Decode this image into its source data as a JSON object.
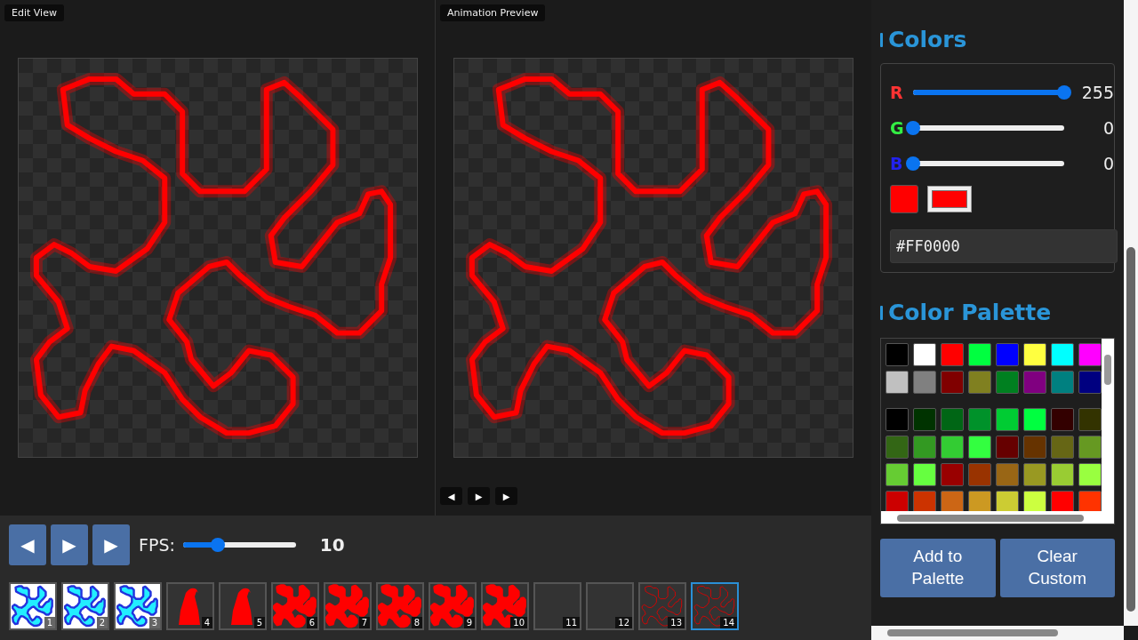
{
  "edit_view": {
    "title": "Edit View"
  },
  "preview": {
    "title": "Animation Preview",
    "controls": [
      "◀",
      "▶",
      "▶"
    ]
  },
  "playback": {
    "buttons": [
      "◀",
      "▶",
      "▶"
    ],
    "fps": {
      "label": "FPS:",
      "level": 0.31,
      "value": "10"
    }
  },
  "frames": [
    {
      "number": "1",
      "kind": "blue-blob",
      "selected": false
    },
    {
      "number": "2",
      "kind": "blue-blob",
      "selected": false
    },
    {
      "number": "3",
      "kind": "blue-blob",
      "selected": false
    },
    {
      "number": "4",
      "kind": "red-ghost",
      "selected": false
    },
    {
      "number": "5",
      "kind": "red-ghost",
      "selected": false
    },
    {
      "number": "6",
      "kind": "red-blob",
      "selected": false
    },
    {
      "number": "7",
      "kind": "red-blob",
      "selected": false
    },
    {
      "number": "8",
      "kind": "red-blob",
      "selected": false
    },
    {
      "number": "9",
      "kind": "red-blob",
      "selected": false
    },
    {
      "number": "10",
      "kind": "red-blob",
      "selected": false
    },
    {
      "number": "11",
      "kind": "empty",
      "selected": false
    },
    {
      "number": "12",
      "kind": "empty",
      "selected": false
    },
    {
      "number": "13",
      "kind": "red-outline",
      "selected": false
    },
    {
      "number": "14",
      "kind": "red-outline",
      "selected": true
    }
  ],
  "colors": {
    "title": "Colors",
    "channels": [
      {
        "label": "R",
        "color": "#ff3333",
        "level": 1,
        "value": "255"
      },
      {
        "label": "G",
        "color": "#33ee44",
        "level": 0,
        "value": "0"
      },
      {
        "label": "B",
        "color": "#2222ee",
        "level": 0,
        "value": "0"
      }
    ],
    "hex": "#FF0000"
  },
  "palette": {
    "title": "Color Palette",
    "base": [
      {
        "color": "#000000"
      },
      {
        "color": "#ffffff"
      },
      {
        "color": "#ff0000"
      },
      {
        "color": "#00ff40"
      },
      {
        "color": "#0000ff"
      },
      {
        "color": "#ffff40"
      },
      {
        "color": "#00ffff"
      },
      {
        "color": "#ff00ff"
      },
      {
        "color": "#c0c0c0"
      },
      {
        "color": "#808080"
      },
      {
        "color": "#800000"
      },
      {
        "color": "#808020"
      },
      {
        "color": "#008020"
      },
      {
        "color": "#800080"
      },
      {
        "color": "#008080"
      },
      {
        "color": "#000080"
      }
    ],
    "custom": [
      {
        "color": "#000000"
      },
      {
        "color": "#003300"
      },
      {
        "color": "#006615"
      },
      {
        "color": "#00922a"
      },
      {
        "color": "#00cc33"
      },
      {
        "color": "#00ff40"
      },
      {
        "color": "#330000"
      },
      {
        "color": "#333300"
      },
      {
        "color": "#336615"
      },
      {
        "color": "#339922"
      },
      {
        "color": "#33cc33"
      },
      {
        "color": "#33ff40"
      },
      {
        "color": "#660000"
      },
      {
        "color": "#663300"
      },
      {
        "color": "#666615"
      },
      {
        "color": "#669922"
      },
      {
        "color": "#66cc33"
      },
      {
        "color": "#66ff40"
      },
      {
        "color": "#990000"
      },
      {
        "color": "#993300"
      },
      {
        "color": "#996615"
      },
      {
        "color": "#999922"
      },
      {
        "color": "#99cc33"
      },
      {
        "color": "#99ff40"
      },
      {
        "color": "#cc0000"
      },
      {
        "color": "#cc3300"
      },
      {
        "color": "#cc6615"
      },
      {
        "color": "#cc9922"
      },
      {
        "color": "#cccc33"
      },
      {
        "color": "#ccff40"
      },
      {
        "color": "#ff0000"
      },
      {
        "color": "#ff3300"
      }
    ],
    "buttons": [
      "Add to Palette",
      "Clear Custom"
    ]
  }
}
